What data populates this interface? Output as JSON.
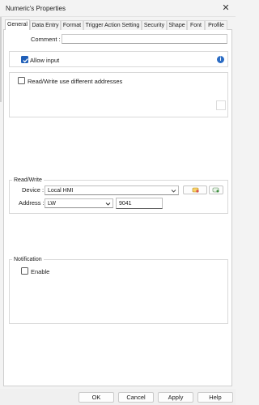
{
  "window": {
    "title": "Numeric's Properties",
    "close_glyph": "✕"
  },
  "tabs": [
    {
      "label": "General",
      "active": true
    },
    {
      "label": "Data Entry"
    },
    {
      "label": "Format"
    },
    {
      "label": "Trigger Action Setting"
    },
    {
      "label": "Security"
    },
    {
      "label": "Shape"
    },
    {
      "label": "Font"
    },
    {
      "label": "Profile"
    }
  ],
  "general": {
    "comment_label": "Comment :",
    "comment_value": "",
    "allow_input_label": "Allow input",
    "allow_input_checked": true,
    "info_glyph": "i",
    "rw_different_label": "Read/Write use different addresses",
    "rw_different_checked": false
  },
  "read_write": {
    "group_title": "Read/Write",
    "device_label": "Device :",
    "device_value": "Local HMI",
    "address_label": "Address :",
    "address_type": "LW",
    "address_value": "9041"
  },
  "notification": {
    "group_title": "Notification",
    "enable_label": "Enable",
    "enable_checked": false
  },
  "buttons": {
    "ok": "OK",
    "cancel": "Cancel",
    "apply": "Apply",
    "help": "Help"
  },
  "colors": {
    "accent": "#1f5fb8",
    "info": "#2b6cc4"
  }
}
